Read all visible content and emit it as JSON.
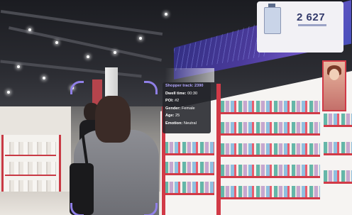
{
  "ad": {
    "price": "2 627"
  },
  "tracking": {
    "title": "Shopper track: 2390",
    "rows": [
      {
        "label": "Dwell time:",
        "value": "00:30"
      },
      {
        "label": "POI:",
        "value": "#2"
      },
      {
        "label": "Gender:",
        "value": "Female"
      },
      {
        "label": "Age:",
        "value": "25"
      },
      {
        "label": "Emotion:",
        "value": "Neutral"
      }
    ]
  },
  "colors": {
    "accent": "#8f7fe6",
    "shelf_red": "#d13a47",
    "overlay_bg": "#23242a"
  }
}
